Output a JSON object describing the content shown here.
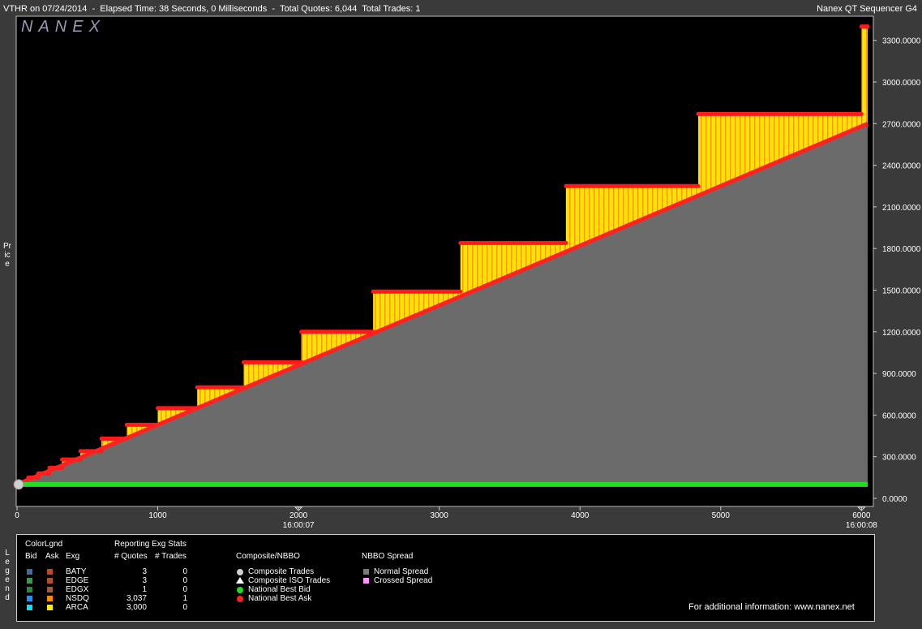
{
  "header": {
    "title_left": "VTHR on 07/24/2014  -  Elapsed Time: 38 Seconds, 0 Milliseconds  -  Total Quotes: 6,044  Total Trades: 1",
    "title_right": "Nanex QT Sequencer G4",
    "logo": "NANEX"
  },
  "y_axis_label": "Price",
  "chart_data": {
    "type": "area",
    "x_ticks": [
      0,
      1000,
      2000,
      3000,
      4000,
      5000,
      6000
    ],
    "x_time_labels": [
      {
        "x": 2000,
        "label": "16:00:07"
      },
      {
        "x": 6000,
        "label": "16:00:08"
      }
    ],
    "y_ticks": [
      "0.0000",
      "300.0000",
      "600.0000",
      "900.0000",
      "1200.0000",
      "1500.0000",
      "1800.0000",
      "2100.0000",
      "2400.0000",
      "2700.0000",
      "3000.0000",
      "3300.0000"
    ],
    "xlim": [
      0,
      6044
    ],
    "ylim": [
      -60,
      3430
    ],
    "national_best_bid": {
      "x": [
        0,
        6044
      ],
      "y": [
        100,
        100
      ],
      "color": "#22dd22"
    },
    "national_best_ask_ramp": {
      "x": [
        0,
        6044
      ],
      "y": [
        100,
        2700
      ],
      "color": "#ff2020"
    },
    "ask_steps": [
      {
        "x0": 80,
        "x1": 150,
        "y": 150
      },
      {
        "x0": 150,
        "x1": 230,
        "y": 180
      },
      {
        "x0": 230,
        "x1": 320,
        "y": 220
      },
      {
        "x0": 320,
        "x1": 450,
        "y": 280
      },
      {
        "x0": 450,
        "x1": 600,
        "y": 340
      },
      {
        "x0": 600,
        "x1": 780,
        "y": 430
      },
      {
        "x0": 780,
        "x1": 1000,
        "y": 530
      },
      {
        "x0": 1000,
        "x1": 1280,
        "y": 650
      },
      {
        "x0": 1280,
        "x1": 1610,
        "y": 800
      },
      {
        "x0": 1610,
        "x1": 2020,
        "y": 980
      },
      {
        "x0": 2020,
        "x1": 2530,
        "y": 1200
      },
      {
        "x0": 2530,
        "x1": 3150,
        "y": 1490
      },
      {
        "x0": 3150,
        "x1": 3900,
        "y": 1840
      },
      {
        "x0": 3900,
        "x1": 4840,
        "y": 2250
      },
      {
        "x0": 4840,
        "x1": 6000,
        "y": 2770
      },
      {
        "x0": 6000,
        "x1": 6044,
        "y": 3400
      }
    ],
    "composite_trade": {
      "x": 0,
      "y": 100
    },
    "colors": {
      "spread_fill": "#6b6b6b",
      "ask_fill_yellow": "#ffee00",
      "ask_fill_orange": "#ff9900",
      "ask_line": "#ff1a1a"
    }
  },
  "legend": {
    "side_label": "Legend",
    "color_legend_title": "ColorLgnd",
    "col_bid": "Bid",
    "col_ask": "Ask",
    "col_exg": "Exg",
    "stats_title": "Reporting Exg Stats",
    "col_quotes": "# Quotes",
    "col_trades": "# Trades",
    "exchanges": [
      {
        "name": "BATY",
        "quotes": "3",
        "trades": "0",
        "bid_color": "#3a6ea5",
        "ask_color": "#c8461e"
      },
      {
        "name": "EDGE",
        "quotes": "3",
        "trades": "0",
        "bid_color": "#3a9a4a",
        "ask_color": "#b05030"
      },
      {
        "name": "EDGX",
        "quotes": "1",
        "trades": "0",
        "bid_color": "#2a8a3a",
        "ask_color": "#a05a40"
      },
      {
        "name": "NSDQ",
        "quotes": "3,037",
        "trades": "1",
        "bid_color": "#1e90ff",
        "ask_color": "#ff8c00"
      },
      {
        "name": "ARCA",
        "quotes": "3,000",
        "trades": "0",
        "bid_color": "#00e5ff",
        "ask_color": "#ffee00"
      }
    ],
    "composite_title": "Composite/NBBO",
    "composite_items": [
      "Composite Trades",
      "Composite ISO Trades",
      "National Best Bid",
      "National Best Ask"
    ],
    "spread_title": "NBBO Spread",
    "spread_items": [
      {
        "label": "Normal Spread",
        "color": "#7a7a7a"
      },
      {
        "label": "Crossed Spread",
        "color": "#ff99ff"
      }
    ],
    "info": "For additional information: www.nanex.net"
  }
}
